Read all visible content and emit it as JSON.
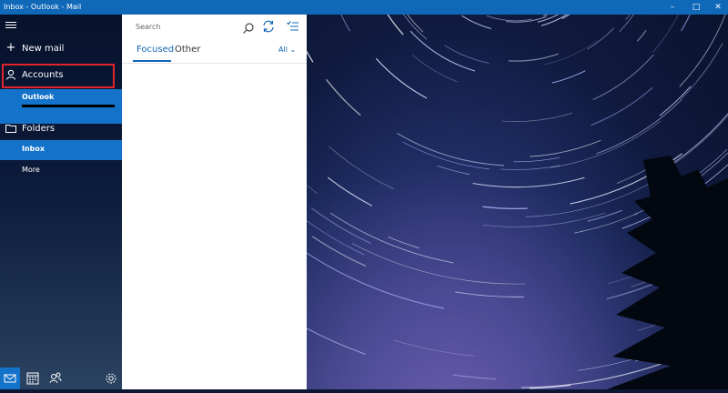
{
  "window": {
    "title": "Inbox - Outlook - Mail",
    "minimize": "–",
    "maximize": "□",
    "close": "✕"
  },
  "nav": {
    "menu_icon": "hamburger-icon",
    "new_mail": "New mail",
    "accounts": "Accounts",
    "account_name": "Outlook",
    "folders": "Folders",
    "inbox": "Inbox",
    "more": "More"
  },
  "bottom_bar": [
    "mail-icon",
    "calendar-icon",
    "people-icon",
    "settings-icon"
  ],
  "list": {
    "search_placeholder": "Search",
    "tab_focused": "Focused",
    "tab_other": "Other",
    "filter": "All"
  },
  "colors": {
    "accent": "#1068b8",
    "highlight_box": "#e0252b",
    "selected": "#1372c9"
  }
}
